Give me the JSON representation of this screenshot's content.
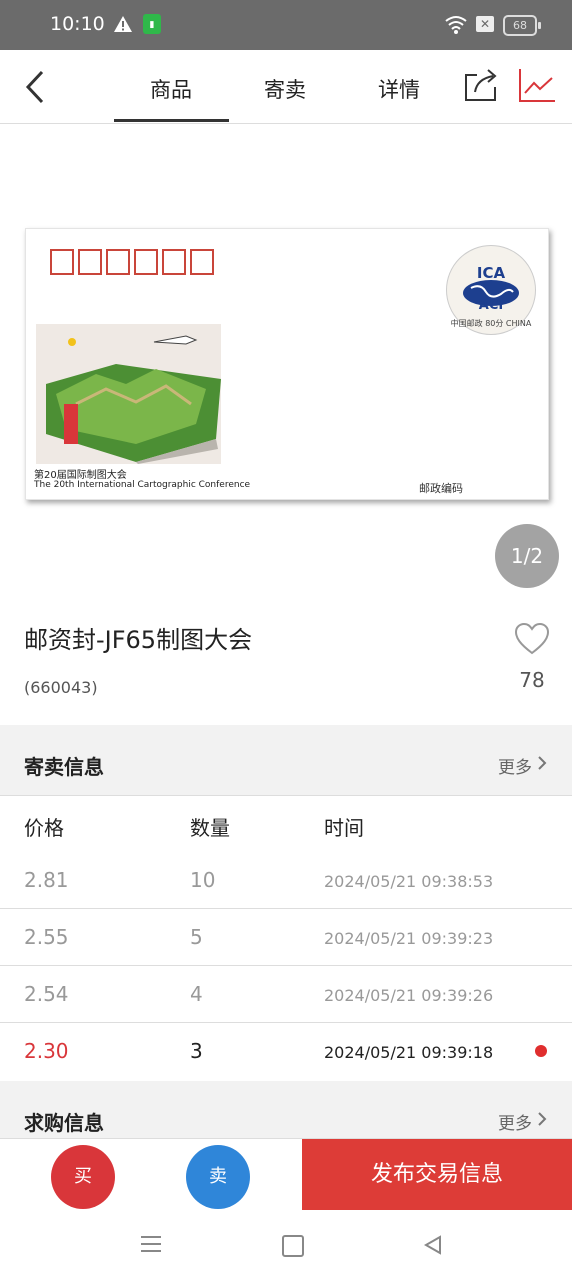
{
  "status_bar": {
    "time": "10:10",
    "battery": "68"
  },
  "nav": {
    "tabs": [
      "商品",
      "寄卖",
      "详情"
    ],
    "active_tab": 0
  },
  "product": {
    "image_pager": "1/2",
    "title": "邮资封-JF65制图大会",
    "code": "(660043)",
    "favorites": "78",
    "envelope": {
      "caption_cn": "第20届国际制图大会",
      "caption_en": "The 20th International Cartographic Conference",
      "postcode_label": "邮政编码",
      "seal_top": "ICA",
      "seal_bottom": "ACI",
      "seal_year": "中国邮政 80分 CHINA"
    }
  },
  "consignment": {
    "title": "寄卖信息",
    "more": "更多",
    "columns": [
      "价格",
      "数量",
      "时间"
    ],
    "rows": [
      {
        "price": "2.81",
        "qty": "10",
        "time": "2024/05/21 09:38:53"
      },
      {
        "price": "2.55",
        "qty": "5",
        "time": "2024/05/21 09:39:23"
      },
      {
        "price": "2.54",
        "qty": "4",
        "time": "2024/05/21 09:39:26"
      },
      {
        "price": "2.30",
        "qty": "3",
        "time": "2024/05/21 09:39:18"
      }
    ]
  },
  "purchase": {
    "title": "求购信息",
    "more": "更多"
  },
  "bottom": {
    "buy": "买",
    "sell": "卖",
    "publish": "发布交易信息"
  },
  "colors": {
    "accent_red": "#dd3c37",
    "buy_red": "#d9363a",
    "sell_blue": "#2f86d9"
  }
}
